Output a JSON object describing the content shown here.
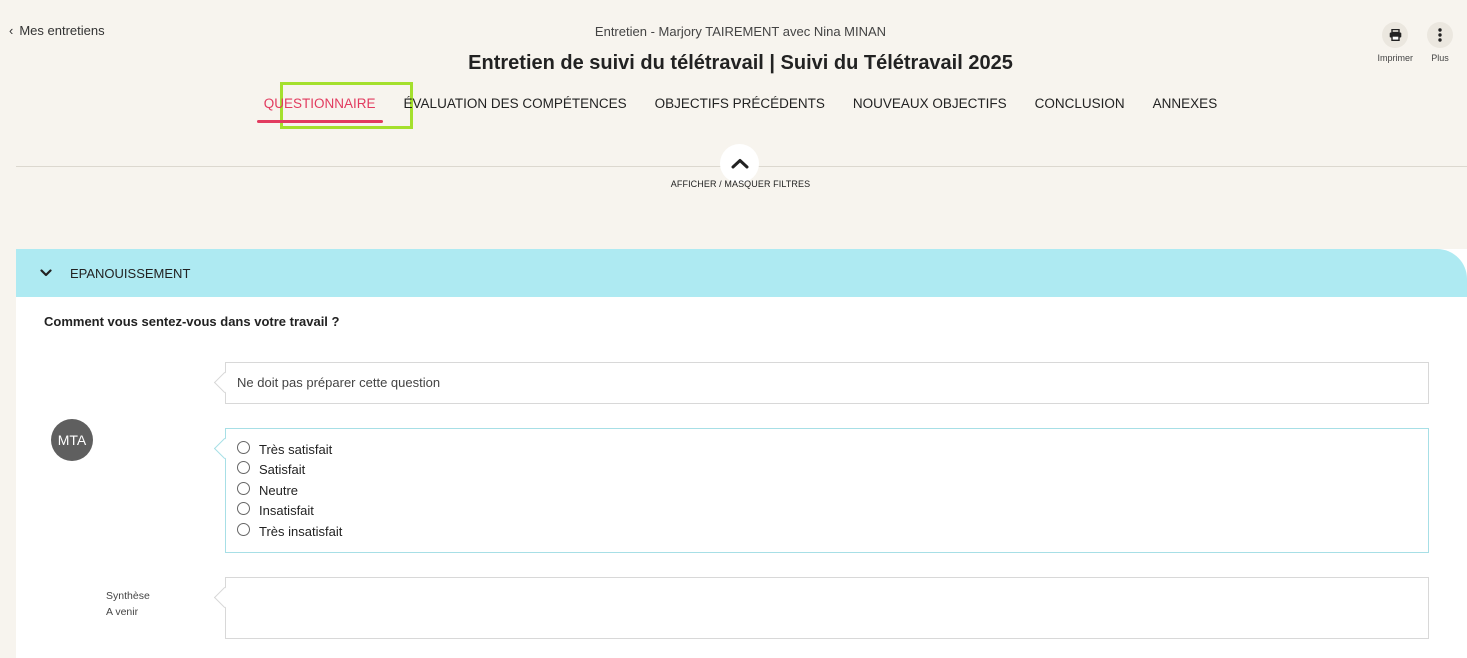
{
  "header": {
    "back_label": "Mes entretiens",
    "subtitle": "Entretien - Marjory TAIREMENT avec Nina MINAN",
    "title": "Entretien de suivi du télétravail | Suivi du Télétravail 2025"
  },
  "actions": {
    "print_label": "Imprimer",
    "more_label": "Plus"
  },
  "tabs": [
    {
      "label": "QUESTIONNAIRE",
      "active": true
    },
    {
      "label": "ÉVALUATION DES COMPÉTENCES",
      "active": false
    },
    {
      "label": "OBJECTIFS PRÉCÉDENTS",
      "active": false
    },
    {
      "label": "NOUVEAUX OBJECTIFS",
      "active": false
    },
    {
      "label": "CONCLUSION",
      "active": false
    },
    {
      "label": "ANNEXES",
      "active": false
    }
  ],
  "filters": {
    "toggle_label": "AFFICHER / MASQUER FILTRES"
  },
  "section": {
    "title": "EPANOUISSEMENT",
    "question": "Comment vous sentez-vous dans votre travail ?",
    "preparation_note": "Ne doit pas préparer cette question",
    "avatar_initials": "MTA",
    "options": [
      "Très satisfait",
      "Satisfait",
      "Neutre",
      "Insatisfait",
      "Très insatisfait"
    ],
    "synthese_label": "Synthèse",
    "synthese_status": "A venir"
  },
  "colors": {
    "accent": "#e23b5f",
    "highlight": "#a4e02d",
    "section_header": "#aeeaf2"
  }
}
